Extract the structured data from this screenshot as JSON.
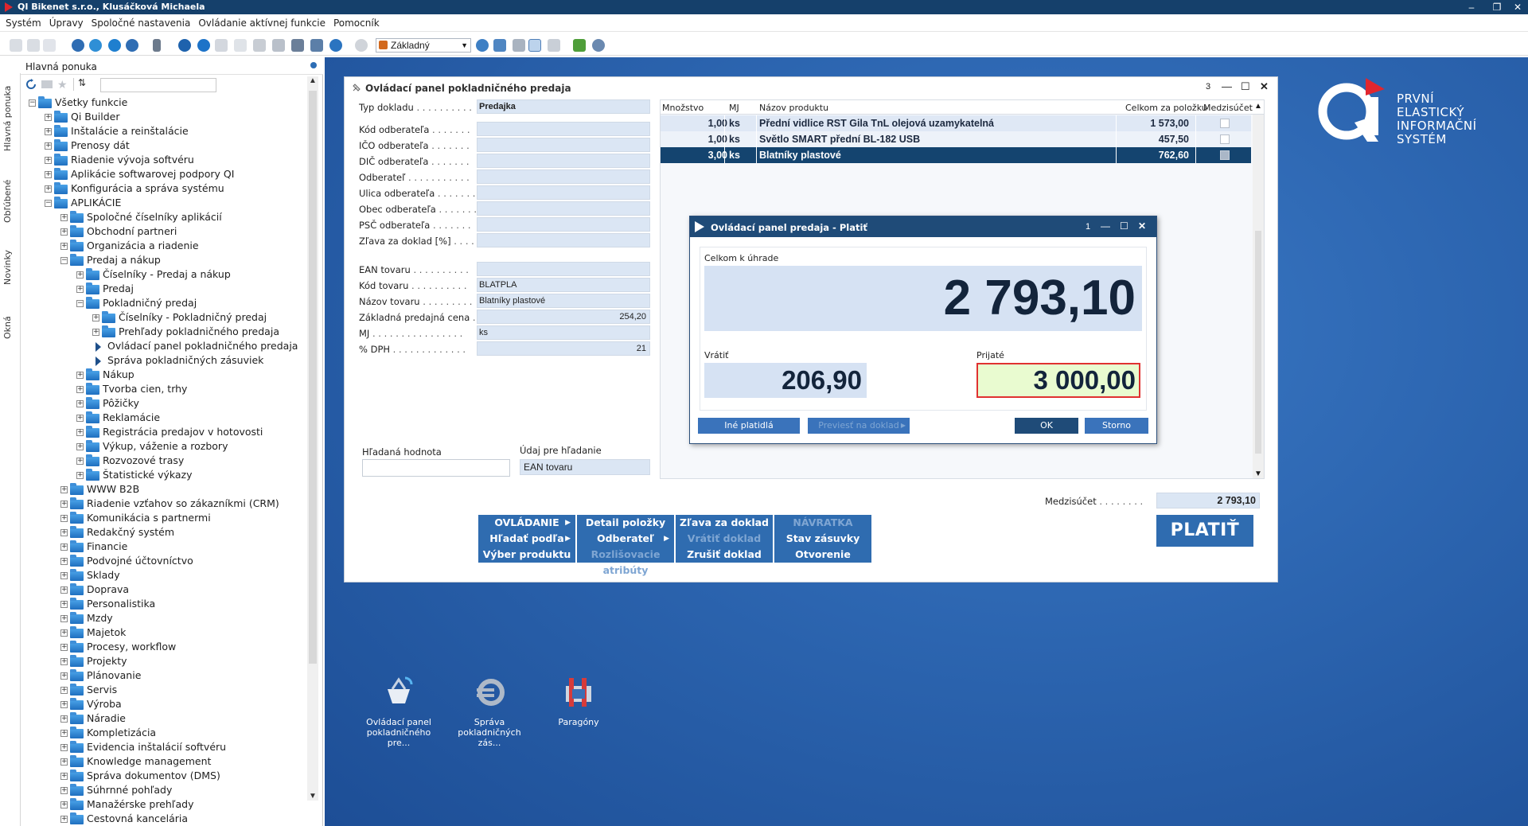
{
  "titlebar": {
    "title": "QI  Bikenet s.r.o., Klusáčková Michaela",
    "controls": [
      "–",
      "❐",
      "✕"
    ]
  },
  "menubar": [
    "Systém",
    "Úpravy",
    "Spoločné nastavenia",
    "Ovládanie aktívnej funkcie",
    "Pomocník"
  ],
  "toolbar": {
    "mode": "Základný"
  },
  "leftrail": {
    "tabs": [
      "Hlavná ponuka",
      "Obľúbené",
      "Novinky",
      "Okná"
    ]
  },
  "navigator": {
    "title": "Hlavná ponuka",
    "tree": [
      {
        "label": "Všetky funkcie",
        "level": 0,
        "exp": "−",
        "type": "folder"
      },
      {
        "label": "Qi Builder",
        "level": 1,
        "exp": "+",
        "type": "folder"
      },
      {
        "label": "Inštalácie a reinštalácie",
        "level": 1,
        "exp": "+",
        "type": "folder"
      },
      {
        "label": "Prenosy dát",
        "level": 1,
        "exp": "+",
        "type": "folder"
      },
      {
        "label": "Riadenie vývoja softvéru",
        "level": 1,
        "exp": "+",
        "type": "folder"
      },
      {
        "label": "Aplikácie softwarovej podpory QI",
        "level": 1,
        "exp": "+",
        "type": "folder"
      },
      {
        "label": "Konfigurácia a správa systému",
        "level": 1,
        "exp": "+",
        "type": "folder"
      },
      {
        "label": "APLIKÁCIE",
        "level": 1,
        "exp": "−",
        "type": "folder"
      },
      {
        "label": "Spoločné číselníky aplikácií",
        "level": 2,
        "exp": "+",
        "type": "folder"
      },
      {
        "label": "Obchodní partneri",
        "level": 2,
        "exp": "+",
        "type": "folder"
      },
      {
        "label": "Organizácia a riadenie",
        "level": 2,
        "exp": "+",
        "type": "folder"
      },
      {
        "label": "Predaj a nákup",
        "level": 2,
        "exp": "−",
        "type": "folder"
      },
      {
        "label": "Číselníky - Predaj a nákup",
        "level": 3,
        "exp": "+",
        "type": "folder"
      },
      {
        "label": "Predaj",
        "level": 3,
        "exp": "+",
        "type": "folder"
      },
      {
        "label": "Pokladničný predaj",
        "level": 3,
        "exp": "−",
        "type": "folder"
      },
      {
        "label": "Číselníky - Pokladničný predaj",
        "level": 4,
        "exp": "+",
        "type": "folder"
      },
      {
        "label": "Prehľady pokladničného predaja",
        "level": 4,
        "exp": "+",
        "type": "folder"
      },
      {
        "label": "Ovládací panel pokladničného predaja",
        "level": 4,
        "exp": "",
        "type": "func"
      },
      {
        "label": "Správa pokladničných zásuviek",
        "level": 4,
        "exp": "",
        "type": "func"
      },
      {
        "label": "Nákup",
        "level": 3,
        "exp": "+",
        "type": "folder"
      },
      {
        "label": "Tvorba cien, trhy",
        "level": 3,
        "exp": "+",
        "type": "folder"
      },
      {
        "label": "Pôžičky",
        "level": 3,
        "exp": "+",
        "type": "folder"
      },
      {
        "label": "Reklamácie",
        "level": 3,
        "exp": "+",
        "type": "folder"
      },
      {
        "label": "Registrácia predajov v hotovosti",
        "level": 3,
        "exp": "+",
        "type": "folder"
      },
      {
        "label": "Výkup, váženie a rozbory",
        "level": 3,
        "exp": "+",
        "type": "folder"
      },
      {
        "label": "Rozvozové trasy",
        "level": 3,
        "exp": "+",
        "type": "folder"
      },
      {
        "label": "Štatistické výkazy",
        "level": 3,
        "exp": "+",
        "type": "folder"
      },
      {
        "label": "WWW B2B",
        "level": 2,
        "exp": "+",
        "type": "folder"
      },
      {
        "label": "Riadenie vzťahov so zákazníkmi (CRM)",
        "level": 2,
        "exp": "+",
        "type": "folder"
      },
      {
        "label": "Komunikácia s partnermi",
        "level": 2,
        "exp": "+",
        "type": "folder"
      },
      {
        "label": "Redakčný systém",
        "level": 2,
        "exp": "+",
        "type": "folder"
      },
      {
        "label": "Financie",
        "level": 2,
        "exp": "+",
        "type": "folder"
      },
      {
        "label": "Podvojné účtovníctvo",
        "level": 2,
        "exp": "+",
        "type": "folder"
      },
      {
        "label": "Sklady",
        "level": 2,
        "exp": "+",
        "type": "folder"
      },
      {
        "label": "Doprava",
        "level": 2,
        "exp": "+",
        "type": "folder"
      },
      {
        "label": "Personalistika",
        "level": 2,
        "exp": "+",
        "type": "folder"
      },
      {
        "label": "Mzdy",
        "level": 2,
        "exp": "+",
        "type": "folder"
      },
      {
        "label": "Majetok",
        "level": 2,
        "exp": "+",
        "type": "folder"
      },
      {
        "label": "Procesy, workflow",
        "level": 2,
        "exp": "+",
        "type": "folder"
      },
      {
        "label": "Projekty",
        "level": 2,
        "exp": "+",
        "type": "folder"
      },
      {
        "label": "Plánovanie",
        "level": 2,
        "exp": "+",
        "type": "folder"
      },
      {
        "label": "Servis",
        "level": 2,
        "exp": "+",
        "type": "folder"
      },
      {
        "label": "Výroba",
        "level": 2,
        "exp": "+",
        "type": "folder"
      },
      {
        "label": "Náradie",
        "level": 2,
        "exp": "+",
        "type": "folder"
      },
      {
        "label": "Kompletizácia",
        "level": 2,
        "exp": "+",
        "type": "folder"
      },
      {
        "label": "Evidencia inštalácií softvéru",
        "level": 2,
        "exp": "+",
        "type": "folder"
      },
      {
        "label": "Knowledge management",
        "level": 2,
        "exp": "+",
        "type": "folder"
      },
      {
        "label": "Správa dokumentov (DMS)",
        "level": 2,
        "exp": "+",
        "type": "folder"
      },
      {
        "label": "Súhrnné pohľady",
        "level": 2,
        "exp": "+",
        "type": "folder"
      },
      {
        "label": "Manažérske prehľady",
        "level": 2,
        "exp": "+",
        "type": "folder"
      },
      {
        "label": "Cestovná kancelária",
        "level": 2,
        "exp": "+",
        "type": "folder"
      }
    ]
  },
  "brand": {
    "lines": [
      "PRVNÍ ELASTICKÝ",
      "INFORMAČNÍ",
      "SYSTÉM"
    ]
  },
  "desktop_icons": [
    {
      "label1": "Ovládací panel",
      "label2": "pokladničného pre..."
    },
    {
      "label1": "Správa",
      "label2": "pokladničných zás..."
    },
    {
      "label1": "Paragóny",
      "label2": ""
    }
  ],
  "mainwin": {
    "title": "Ovládací panel pokladničného predaja",
    "counter": "3",
    "fields": [
      {
        "label": "Typ dokladu",
        "dots": " . . . . . . . . . .",
        "value": "Predajka",
        "bold": true
      },
      {
        "label": "Kód odberateľa",
        "dots": " . . . . . . .",
        "value": ""
      },
      {
        "label": "IČO odberateľa",
        "dots": " . . . . . . .",
        "value": ""
      },
      {
        "label": "DIČ odberateľa",
        "dots": " . . . . . . .",
        "value": ""
      },
      {
        "label": "Odberateľ",
        "dots": " . . . . . . . . . . .",
        "value": ""
      },
      {
        "label": "Ulica odberateľa",
        "dots": " . . . . . . .",
        "value": ""
      },
      {
        "label": "Obec odberateľa",
        "dots": " . . . . . . .",
        "value": ""
      },
      {
        "label": "PSČ odberateľa",
        "dots": " . . . . . . .",
        "value": ""
      },
      {
        "label": "Zľava za doklad [%]",
        "dots": " . . . .",
        "value": ""
      }
    ],
    "product_fields": [
      {
        "label": "EAN tovaru",
        "dots": " . . . . . . . . . .",
        "value": "",
        "align": "left"
      },
      {
        "label": "Kód tovaru",
        "dots": " . . . . . . . . . .",
        "value": "BLATPLA",
        "align": "left"
      },
      {
        "label": "Názov tovaru",
        "dots": " . . . . . . . . .",
        "value": "Blatníky plastové",
        "align": "left"
      },
      {
        "label": "Základná predajná cena",
        "dots": " . .",
        "value": "254,20",
        "align": "right"
      },
      {
        "label": "MJ",
        "dots": " . . . . . . . . . . . . . . . .",
        "value": "ks",
        "align": "left"
      },
      {
        "label": "% DPH",
        "dots": " . . . . . . . . . . . . .",
        "value": "21",
        "align": "right"
      }
    ],
    "search": {
      "label": "Hľadaná hodnota",
      "value": "",
      "by_label": "Údaj pre hľadanie",
      "by_value": "EAN tovaru"
    },
    "grid": {
      "headers": [
        "Množstvo",
        "MJ",
        "Názov produktu",
        "Celkom za položku",
        "Medzisúčet"
      ],
      "rows": [
        {
          "qty": "1,00",
          "mj": "ks",
          "name": "Přední vidlice RST Gila TnL olejová uzamykatelná",
          "total": "1 573,00",
          "selected": false
        },
        {
          "qty": "1,00",
          "mj": "ks",
          "name": "Světlo SMART přední BL-182 USB",
          "total": "457,50",
          "selected": false
        },
        {
          "qty": "3,00",
          "mj": "ks",
          "name": "Blatníky plastové",
          "total": "762,60",
          "selected": true
        }
      ]
    },
    "subtotal": {
      "label": "Medzisúčet",
      "dots": " . . . . . . . .",
      "value": "2 793,10"
    },
    "buttons": [
      {
        "label": "OVLÁDANIE",
        "arrow": true,
        "disabled": false
      },
      {
        "label": "Detail položky",
        "arrow": false,
        "disabled": false
      },
      {
        "label": "Zľava za doklad",
        "arrow": false,
        "disabled": false
      },
      {
        "label": "NÁVRATKA",
        "arrow": false,
        "disabled": true
      },
      {
        "label": "Hľadať podľa",
        "arrow": true,
        "disabled": false
      },
      {
        "label": "Odberateľ",
        "arrow": true,
        "disabled": false
      },
      {
        "label": "Vrátiť doklad",
        "arrow": false,
        "disabled": true
      },
      {
        "label": "Stav zásuvky",
        "arrow": false,
        "disabled": false
      },
      {
        "label": "Výber produktu",
        "arrow": false,
        "disabled": false
      },
      {
        "label": "Rozlišovacie atribúty",
        "arrow": false,
        "disabled": true
      },
      {
        "label": "Zrušiť doklad",
        "arrow": false,
        "disabled": false
      },
      {
        "label": "Otvorenie zásuvky",
        "arrow": false,
        "disabled": false
      }
    ],
    "platit": "PLATIŤ"
  },
  "paydialog": {
    "title": "Ovládací panel predaja - Platiť",
    "counter": "1",
    "total_label": "Celkom k úhrade",
    "total_value": "2 793,10",
    "change_label": "Vrátiť",
    "change_value": "206,90",
    "received_label": "Prijaté",
    "received_value": "3 000,00",
    "btn_other": "Iné platidlá",
    "btn_transfer": "Previesť na doklad",
    "btn_ok": "OK",
    "btn_cancel": "Storno"
  }
}
